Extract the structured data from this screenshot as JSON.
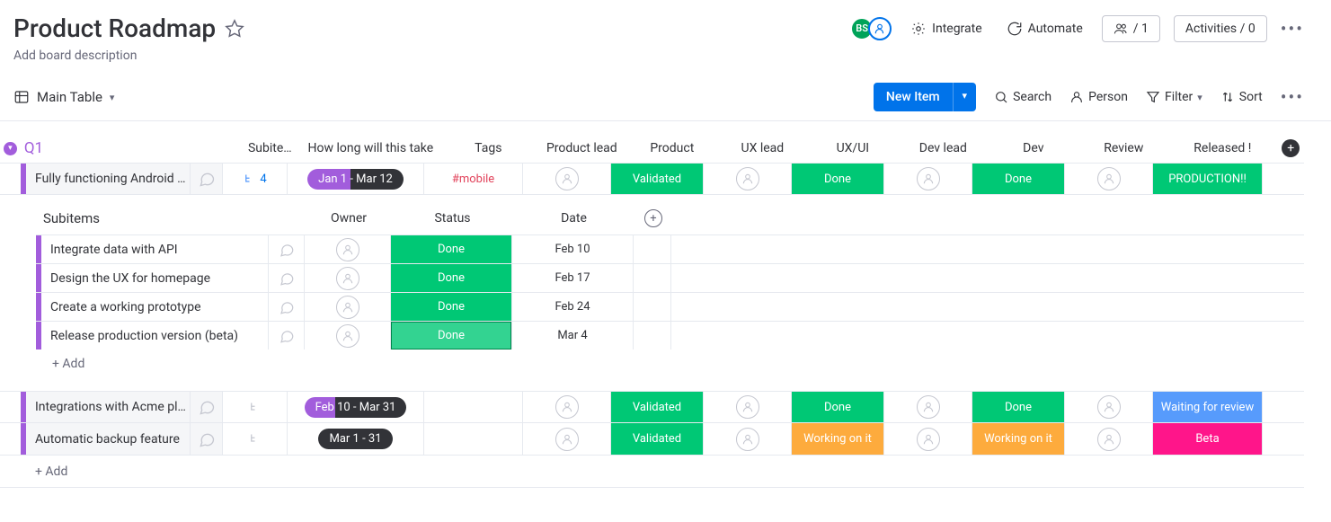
{
  "header": {
    "title": "Product Roadmap",
    "description": "Add board description",
    "avatar_initials": "BS",
    "integrate": "Integrate",
    "automate": "Automate",
    "members_count": "/ 1",
    "activities": "Activities / 0"
  },
  "viewbar": {
    "view_name": "Main Table",
    "new_item": "New Item",
    "search": "Search",
    "person": "Person",
    "filter": "Filter",
    "sort": "Sort"
  },
  "group": {
    "name": "Q1",
    "columns": {
      "subitems": "Subite…",
      "timeline": "How long will this take",
      "tags": "Tags",
      "product_lead": "Product lead",
      "product": "Product",
      "ux_lead": "UX lead",
      "ux_ui": "UX/UI",
      "dev_lead": "Dev lead",
      "dev": "Dev",
      "review": "Review",
      "released": "Released !"
    },
    "rows": [
      {
        "name": "Fully functioning Android …",
        "subitems_count": "4",
        "timeline": "Jan 1 - Mar 12",
        "tags": "#mobile",
        "product": "Validated",
        "ux_ui": "Done",
        "dev": "Done",
        "released": "PRODUCTION!!"
      },
      {
        "name": "Integrations with Acme pl…",
        "timeline": "Feb 10 - Mar 31",
        "product": "Validated",
        "ux_ui": "Done",
        "dev": "Done",
        "released": "Waiting for review"
      },
      {
        "name": "Automatic backup feature",
        "timeline": "Mar 1 - 31",
        "product": "Validated",
        "ux_ui": "Working on it",
        "dev": "Working on it",
        "released": "Beta"
      }
    ],
    "add": "+ Add"
  },
  "subitems": {
    "title": "Subitems",
    "columns": {
      "owner": "Owner",
      "status": "Status",
      "date": "Date"
    },
    "rows": [
      {
        "name": "Integrate data with API",
        "status": "Done",
        "date": "Feb 10"
      },
      {
        "name": "Design the UX for homepage",
        "status": "Done",
        "date": "Feb 17"
      },
      {
        "name": "Create a working prototype",
        "status": "Done",
        "date": "Feb 24"
      },
      {
        "name": "Release production version (beta)",
        "status": "Done",
        "date": "Mar 4"
      }
    ],
    "add": "+ Add"
  }
}
